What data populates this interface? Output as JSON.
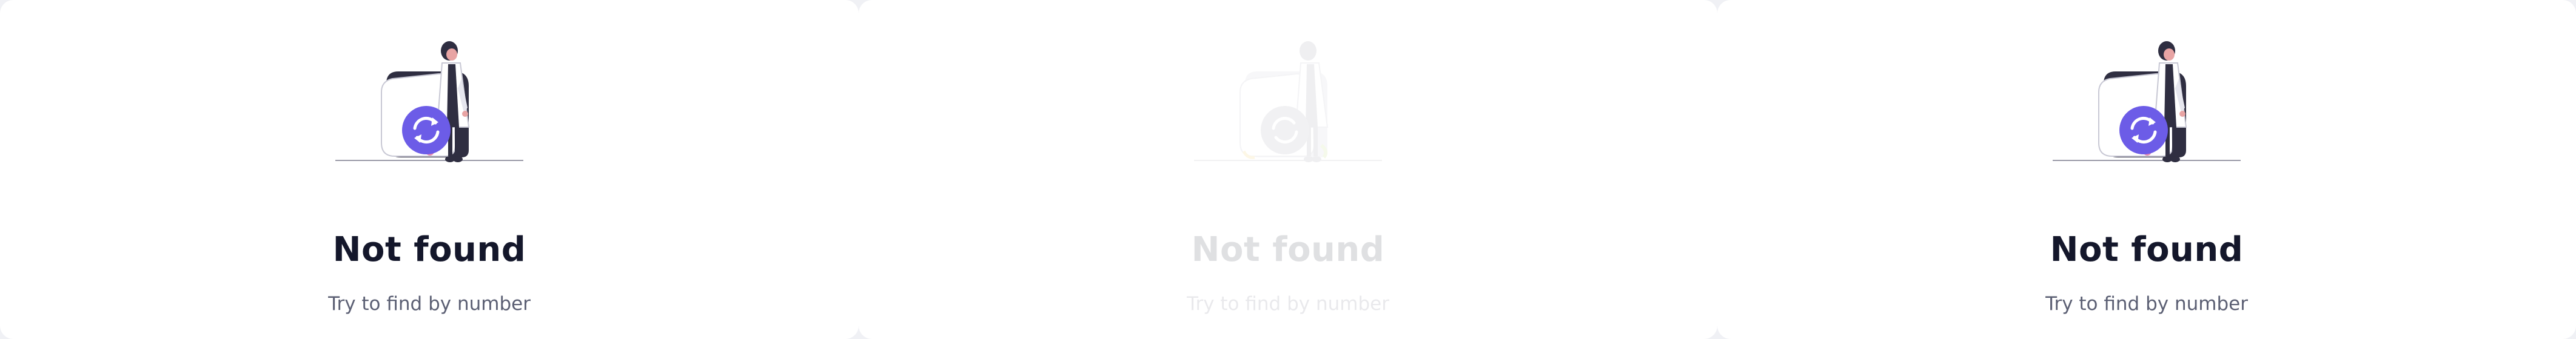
{
  "panels": [
    {
      "title": "Not found",
      "subtitle": "Try to find by number",
      "state": "normal"
    },
    {
      "title": "Not found",
      "subtitle": "Try to find by number",
      "state": "faded"
    },
    {
      "title": "Not found",
      "subtitle": "Try to find by number",
      "state": "normal"
    }
  ],
  "colors": {
    "accent": "#6c5ce7",
    "title": "#14172b",
    "subtitle": "#5b5f73",
    "card_dark": "#2f2e41",
    "figure_hair": "#2f2e41",
    "figure_skin": "#e8a4a4",
    "ground_line": "#9a9aa8",
    "faded_yellow": "#f7c948",
    "faded_green": "#b9d96b"
  },
  "icons": {
    "illustration": "person-with-refresh-card-illustration",
    "center_icon": "refresh-icon"
  }
}
